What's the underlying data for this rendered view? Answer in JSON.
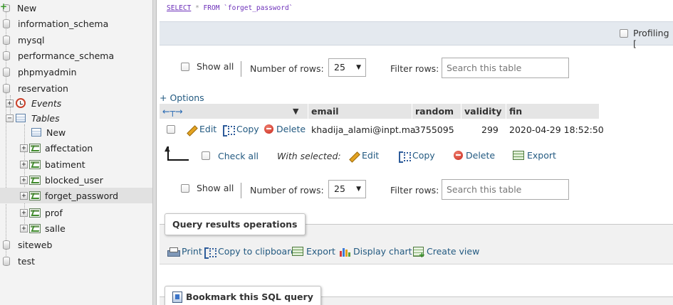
{
  "sidebar": {
    "new_root": "New",
    "databases": [
      {
        "name": "information_schema"
      },
      {
        "name": "mysql"
      },
      {
        "name": "performance_schema"
      },
      {
        "name": "phpmyadmin"
      },
      {
        "name": "reservation"
      },
      {
        "name": "siteweb"
      },
      {
        "name": "test"
      }
    ],
    "reservation_children": {
      "events": "Events",
      "tables": "Tables",
      "new_table": "New",
      "tables_list": [
        "affectation",
        "batiment",
        "blocked_user",
        "forget_password",
        "prof",
        "salle"
      ],
      "active_table": "forget_password"
    }
  },
  "main": {
    "sql": {
      "select": "SELECT",
      "star": "*",
      "from": "FROM",
      "table": "`forget_password`"
    },
    "profiling_label": "Profiling [",
    "nav_top": {
      "show_all": "Show all",
      "rows_label": "Number of rows:",
      "rows_value": "25",
      "filter_label": "Filter rows:",
      "filter_placeholder": "Search this table"
    },
    "options_link": "+ Options",
    "columns": [
      "email",
      "random",
      "validity",
      "fin"
    ],
    "rows": [
      {
        "edit": "Edit",
        "copy": "Copy",
        "delete": "Delete",
        "email": "khadija_alami@inpt.ma",
        "random": "3755095",
        "validity": "299",
        "fin": "2020-04-29 18:52:50"
      }
    ],
    "bulk": {
      "check_all": "Check all",
      "with_selected": "With selected:",
      "edit": "Edit",
      "copy": "Copy",
      "delete": "Delete",
      "export": "Export"
    },
    "nav_bottom": {
      "show_all": "Show all",
      "rows_label": "Number of rows:",
      "rows_value": "25",
      "filter_label": "Filter rows:",
      "filter_placeholder": "Search this table"
    },
    "qro": {
      "title": "Query results operations",
      "print": "Print",
      "copy_clipboard": "Copy to clipboard",
      "export": "Export",
      "display_chart": "Display chart",
      "create_view": "Create view"
    },
    "bookmark": {
      "title": "Bookmark this SQL query"
    }
  }
}
